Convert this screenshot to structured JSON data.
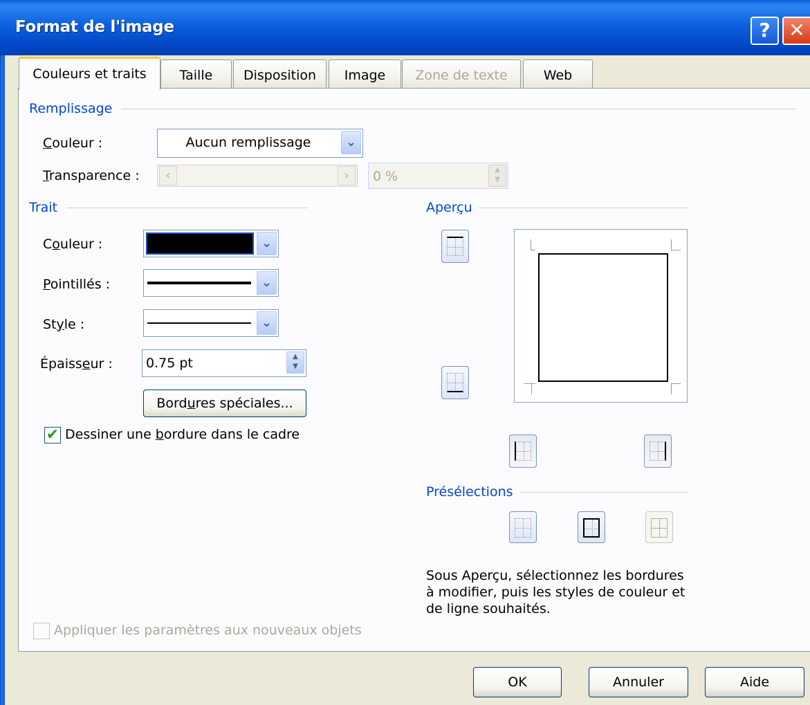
{
  "window": {
    "title": "Format de l'image",
    "help_glyph": "?",
    "close_glyph": "✕"
  },
  "tabs": [
    {
      "label": "Couleurs et traits",
      "state": "active"
    },
    {
      "label": "Taille",
      "state": "normal"
    },
    {
      "label": "Disposition",
      "state": "normal"
    },
    {
      "label": "Image",
      "state": "normal"
    },
    {
      "label": "Zone de texte",
      "state": "disabled"
    },
    {
      "label": "Web",
      "state": "normal"
    }
  ],
  "fill": {
    "heading": "Remplissage",
    "color_label_key": "C",
    "color_label_rest": "ouleur :",
    "color_value": "Aucun remplissage",
    "transparency_label_key": "T",
    "transparency_label_rest": "ransparence :",
    "transparency_value": "0 %",
    "transparency_level": 0
  },
  "line": {
    "heading": "Trait",
    "color_label_pre": "C",
    "color_label_key": "o",
    "color_label_rest": "uleur :",
    "color_value": "#000000",
    "dash_label_key": "P",
    "dash_label_rest": "ointillés :",
    "style_label_pre": "St",
    "style_label_key": "y",
    "style_label_rest": "le :",
    "weight_label_pre": "Épaiss",
    "weight_label_key": "e",
    "weight_label_rest": "ur :",
    "weight_value": "0.75  pt",
    "special_borders_pre": "Bord",
    "special_borders_key": "u",
    "special_borders_rest": "res spéciales...",
    "draw_inside_pre": "Dessiner une ",
    "draw_inside_key": "b",
    "draw_inside_rest": "ordure dans le cadre",
    "draw_inside_checked": true
  },
  "preview": {
    "heading_pre": "Aper",
    "heading_key": "ç",
    "heading_rest": "u"
  },
  "presets": {
    "heading": "Présélections",
    "hint": "Sous Aperçu, sélectionnez les bordures à modifier, puis les styles de couleur et de ligne souhaités."
  },
  "apply_new_objects": {
    "label": "Appliquer les paramètres aux nouveaux objets",
    "checked": false
  },
  "footer": {
    "ok": "OK",
    "cancel": "Annuler",
    "help": "Aide"
  },
  "icons": {
    "dropdown": "chevron-down-icon",
    "check": "✔",
    "chevron": "❯"
  },
  "colors": {
    "accent": "#0046d5",
    "title_bar": "#0c60de",
    "dialog_bg": "#ece9d8",
    "panel_bg": "#fcfcfe"
  }
}
